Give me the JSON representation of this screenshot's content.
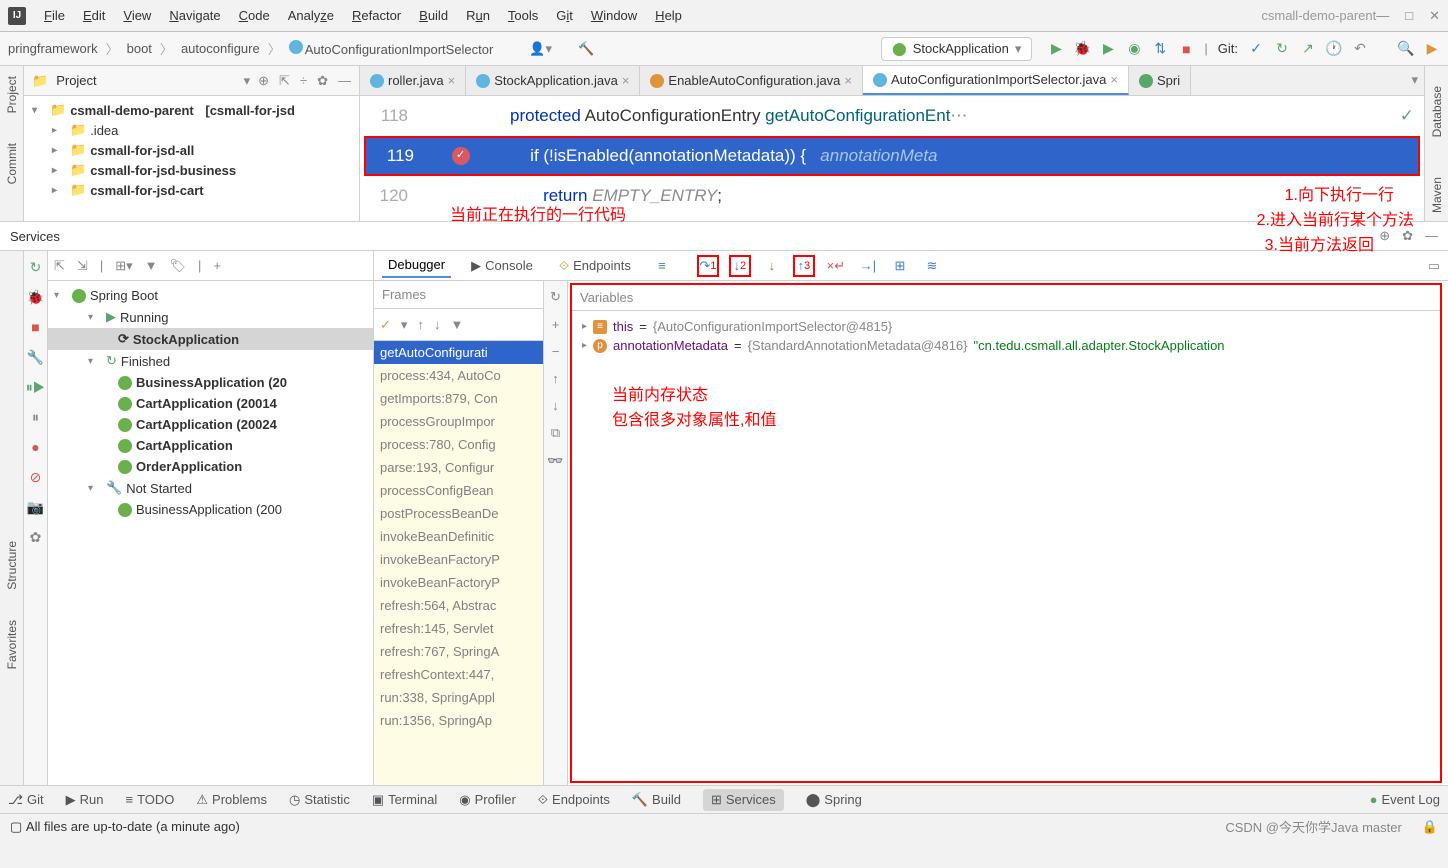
{
  "window": {
    "title": "csmall-demo-parent",
    "menu": [
      "File",
      "Edit",
      "View",
      "Navigate",
      "Code",
      "Analyze",
      "Refactor",
      "Build",
      "Run",
      "Tools",
      "Git",
      "Window",
      "Help"
    ]
  },
  "breadcrumb": [
    "pringframework",
    "boot",
    "autoconfigure",
    "AutoConfigurationImportSelector"
  ],
  "runConfig": "StockApplication",
  "gitLabel": "Git:",
  "project": {
    "title": "Project",
    "root": "csmall-demo-parent",
    "rootSuffix": "[csmall-for-jsd",
    "children": [
      ".idea",
      "csmall-for-jsd-all",
      "csmall-for-jsd-business",
      "csmall-for-jsd-cart"
    ]
  },
  "tabs": [
    {
      "label": "roller.java",
      "cls": ""
    },
    {
      "label": "StockApplication.java",
      "cls": ""
    },
    {
      "label": "EnableAutoConfiguration.java",
      "cls": "orange"
    },
    {
      "label": "AutoConfigurationImportSelector.java",
      "cls": "active"
    },
    {
      "label": "Spri",
      "cls": "green"
    }
  ],
  "code": {
    "lines": [
      {
        "n": "118",
        "html": "<span class='kw'>protected</span> AutoConfigurationEntry <span class='meth'>getAutoConfigurationEnt</span>"
      },
      {
        "n": "119",
        "hl": true,
        "html": "   <span class='kw'>if</span> (!isEnabled(annotationMetadata)) {   <span class='comm'>annotationMeta</span>"
      },
      {
        "n": "120",
        "html": "       <span class='kw'>return</span> <span class='comm'>EMPTY_ENTRY</span>;"
      }
    ]
  },
  "annotations": {
    "a1": "当前正在执行的一行代码",
    "a2_1": "1.向下执行一行",
    "a2_2": "2.进入当前行某个方法",
    "a2_3": "3.当前方法返回",
    "a3_1": "当前内存状态",
    "a3_2": "包含很多对象属性,和值"
  },
  "services": {
    "header": "Services",
    "tree": {
      "root": "Spring Boot",
      "running": "Running",
      "runningItems": [
        "StockApplication"
      ],
      "finished": "Finished",
      "finishedItems": [
        "BusinessApplication (20",
        "CartApplication (20014",
        "CartApplication (20024",
        "CartApplication",
        "OrderApplication"
      ],
      "notStarted": "Not Started",
      "notStartedItems": [
        "BusinessApplication (200"
      ]
    }
  },
  "debugger": {
    "tabs": [
      "Debugger",
      "Console",
      "Endpoints"
    ],
    "framesTitle": "Frames",
    "frames": [
      "getAutoConfigurati",
      "process:434, AutoCo",
      "getImports:879, Con",
      "processGroupImpor",
      "process:780, Config",
      "parse:193, Configur",
      "processConfigBean",
      "postProcessBeanDe",
      "invokeBeanDefinitic",
      "invokeBeanFactoryP",
      "invokeBeanFactoryP",
      "refresh:564, Abstrac",
      "refresh:145, Servlet",
      "refresh:767, SpringA",
      "refreshContext:447,",
      "run:338, SpringAppl",
      "run:1356, SpringAp"
    ],
    "varsTitle": "Variables",
    "vars": [
      {
        "name": "this",
        "val": "{AutoConfigurationImportSelector@4815}",
        "icon": "f"
      },
      {
        "name": "annotationMetadata",
        "val": "{StandardAnnotationMetadata@4816}",
        "str": "\"cn.tedu.csmall.all.adapter.StockApplication",
        "icon": "p"
      }
    ]
  },
  "bottomTabs": [
    "Git",
    "Run",
    "TODO",
    "Problems",
    "Statistic",
    "Terminal",
    "Profiler",
    "Endpoints",
    "Build",
    "Services",
    "Spring"
  ],
  "eventLog": "Event Log",
  "status": {
    "left": "All files are up-to-date (a minute ago)",
    "right": "CSDN @今天你学Java master"
  },
  "sideLabels": {
    "project": "Project",
    "commit": "Commit",
    "structure": "Structure",
    "favorites": "Favorites",
    "database": "Database",
    "maven": "Maven"
  }
}
